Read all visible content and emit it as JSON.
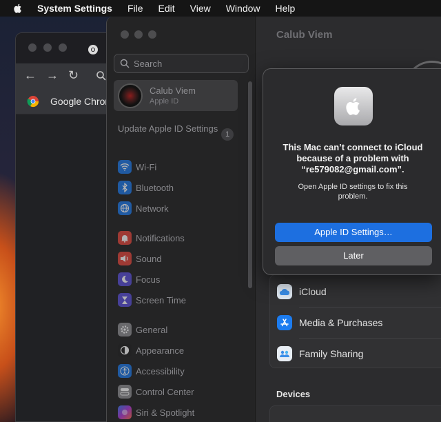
{
  "menubar": {
    "app_name": "System Settings",
    "items": [
      "File",
      "Edit",
      "View",
      "Window",
      "Help"
    ]
  },
  "chrome": {
    "bookmark_label": "Google Chrome"
  },
  "sidebar": {
    "search_placeholder": "Search",
    "account": {
      "name": "Calub Viem",
      "subtitle": "Apple ID"
    },
    "update": {
      "label": "Update Apple ID Settings",
      "badge": "1"
    },
    "items": [
      {
        "label": "Wi-Fi",
        "icon": "wifi-icon",
        "color": "#1e78e6"
      },
      {
        "label": "Bluetooth",
        "icon": "bluetooth-icon",
        "color": "#1e78e6"
      },
      {
        "label": "Network",
        "icon": "globe-icon",
        "color": "#1e78e6"
      },
      {
        "label": "Notifications",
        "icon": "bell-icon",
        "color": "#e0473c"
      },
      {
        "label": "Sound",
        "icon": "speaker-icon",
        "color": "#e0473c"
      },
      {
        "label": "Focus",
        "icon": "moon-icon",
        "color": "#5b4fd6"
      },
      {
        "label": "Screen Time",
        "icon": "hourglass-icon",
        "color": "#5b4fd6"
      },
      {
        "label": "General",
        "icon": "gear-icon",
        "color": "#8e8e93"
      },
      {
        "label": "Appearance",
        "icon": "appearance-icon",
        "color": "#222222"
      },
      {
        "label": "Accessibility",
        "icon": "accessibility-icon",
        "color": "#1e78e6"
      },
      {
        "label": "Control Center",
        "icon": "control-center-icon",
        "color": "#8e8e93"
      },
      {
        "label": "Siri & Spotlight",
        "icon": "siri-icon",
        "color": "#b03ad8"
      }
    ]
  },
  "main": {
    "title": "Calub Viem",
    "rows": [
      {
        "label": "iCloud",
        "icon": "cloud-icon",
        "color": "#dfe8f2"
      },
      {
        "label": "Media & Purchases",
        "icon": "app-store-icon",
        "color": "#1c7cf0"
      },
      {
        "label": "Family Sharing",
        "icon": "family-icon",
        "color": "#e8eef4"
      }
    ],
    "devices_heading": "Devices"
  },
  "dialog": {
    "title": "This Mac can’t connect to iCloud because of a problem with “re579082@gmail.com”.",
    "message": "Open Apple ID settings to fix this problem.",
    "primary_button": "Apple ID Settings…",
    "secondary_button": "Later"
  }
}
